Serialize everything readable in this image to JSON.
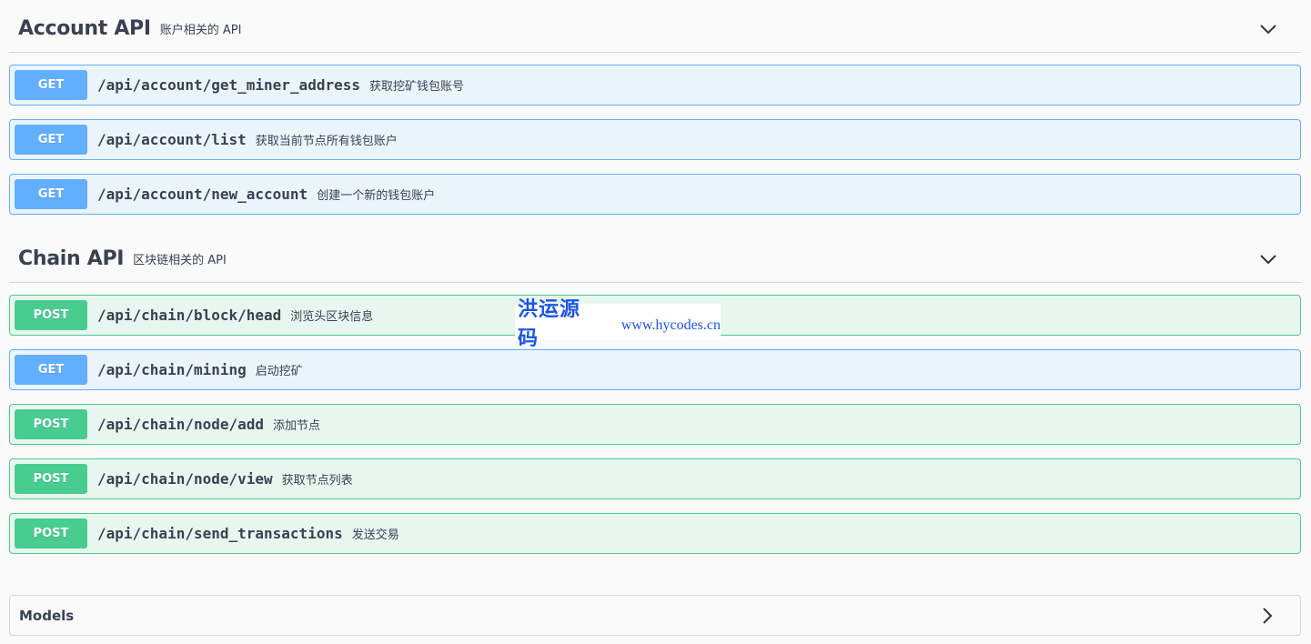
{
  "account": {
    "title": "Account API",
    "description": "账户相关的 API",
    "operations": [
      {
        "method": "GET",
        "path": "/api/account/get_miner_address",
        "summary": "获取挖矿钱包账号"
      },
      {
        "method": "GET",
        "path": "/api/account/list",
        "summary": "获取当前节点所有钱包账户"
      },
      {
        "method": "GET",
        "path": "/api/account/new_account",
        "summary": "创建一个新的钱包账户"
      }
    ]
  },
  "chain": {
    "title": "Chain API",
    "description": "区块链相关的 API",
    "operations": [
      {
        "method": "POST",
        "path": "/api/chain/block/head",
        "summary": "浏览头区块信息"
      },
      {
        "method": "GET",
        "path": "/api/chain/mining",
        "summary": "启动挖矿"
      },
      {
        "method": "POST",
        "path": "/api/chain/node/add",
        "summary": "添加节点"
      },
      {
        "method": "POST",
        "path": "/api/chain/node/view",
        "summary": "获取节点列表"
      },
      {
        "method": "POST",
        "path": "/api/chain/send_transactions",
        "summary": "发送交易"
      }
    ]
  },
  "models": {
    "title": "Models"
  },
  "watermark": {
    "cn": "洪运源码",
    "url": "www.hycodes.cn"
  },
  "icons": {
    "collapse": "chevron-down-icon",
    "expand": "chevron-right-icon"
  },
  "colors": {
    "get": "#61affe",
    "post": "#49cc90",
    "watermark": "#1b55e6"
  }
}
